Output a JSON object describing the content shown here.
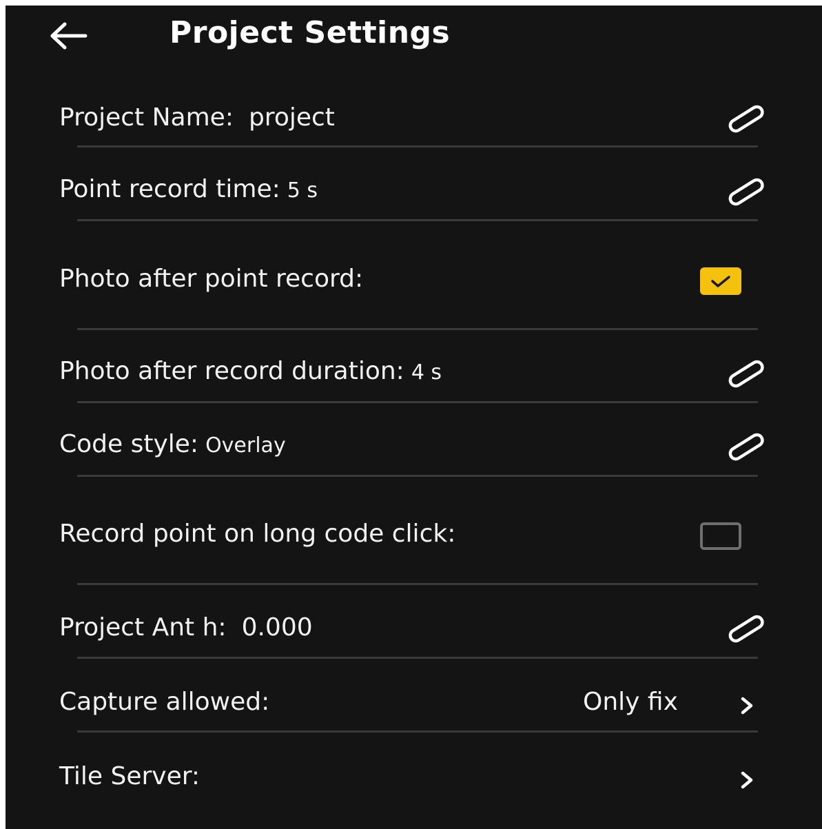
{
  "header": {
    "title": "Project Settings",
    "back_icon": "arrow-left-icon"
  },
  "settings": {
    "project_name": {
      "label": "Project Name:",
      "value": "project",
      "icon": "pencil-icon"
    },
    "point_record_time": {
      "label": "Point record time:",
      "value": "5 s",
      "icon": "pencil-icon"
    },
    "photo_after_point_record": {
      "label": "Photo after point record:",
      "checked": true
    },
    "photo_after_record_duration": {
      "label": "Photo after record duration:",
      "value": "4 s",
      "icon": "pencil-icon"
    },
    "code_style": {
      "label": "Code style:",
      "value": "Overlay",
      "icon": "pencil-icon"
    },
    "record_point_on_long_code_click": {
      "label": "Record point on long code click:",
      "checked": false
    },
    "project_ant_h": {
      "label": "Project Ant h:",
      "value": "0.000",
      "icon": "pencil-icon"
    },
    "capture_allowed": {
      "label": "Capture allowed:",
      "value": "Only fix",
      "icon": "chevron-right-icon"
    },
    "tile_server": {
      "label": "Tile Server:",
      "icon": "chevron-right-icon"
    }
  },
  "colors": {
    "background": "#141414",
    "text": "#f2f2f2",
    "divider": "#3a3a3a",
    "checkbox_checked": "#f4c20d",
    "checkbox_unchecked_border": "#6f6f6f"
  }
}
